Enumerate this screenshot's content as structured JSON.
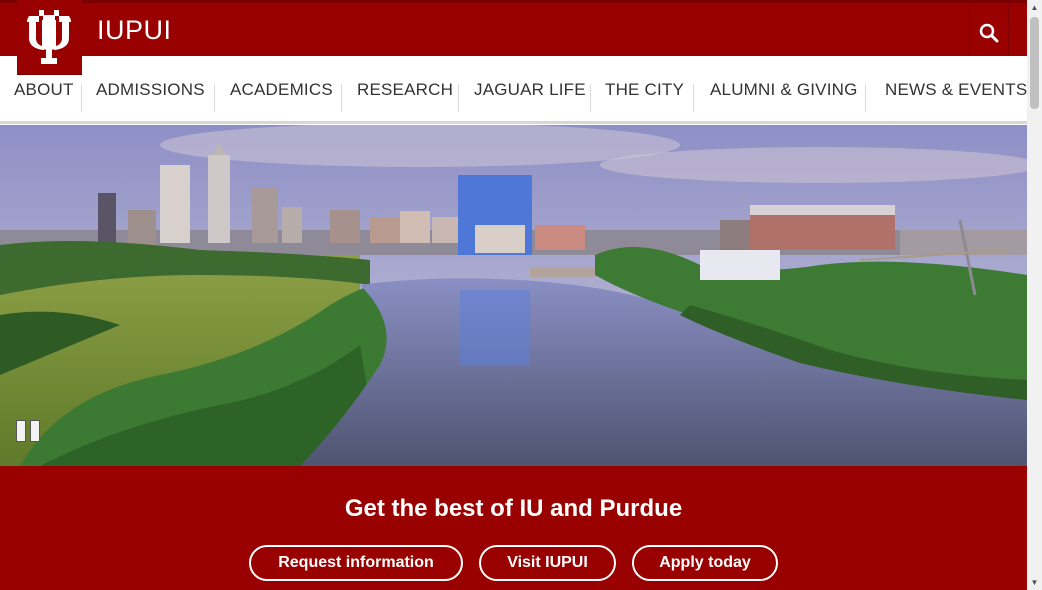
{
  "header": {
    "logo_alt": "IU trident",
    "site_name": "IUPUI",
    "search_icon": "search-icon"
  },
  "nav": {
    "items": [
      {
        "label": "ABOUT"
      },
      {
        "label": "ADMISSIONS"
      },
      {
        "label": "ACADEMICS"
      },
      {
        "label": "RESEARCH"
      },
      {
        "label": "JAGUAR LIFE"
      },
      {
        "label": "THE CITY"
      },
      {
        "label": "ALUMNI & GIVING"
      },
      {
        "label": "NEWS & EVENTS"
      }
    ]
  },
  "hero": {
    "image": "Indianapolis skyline over White River",
    "pause_icon": "pause-icon"
  },
  "cta": {
    "title": "Get the best of IU and Purdue",
    "buttons": [
      {
        "label": "Request information"
      },
      {
        "label": "Visit IUPUI"
      },
      {
        "label": "Apply today"
      }
    ]
  },
  "colors": {
    "brand": "#990000",
    "nav_text": "#333333"
  }
}
